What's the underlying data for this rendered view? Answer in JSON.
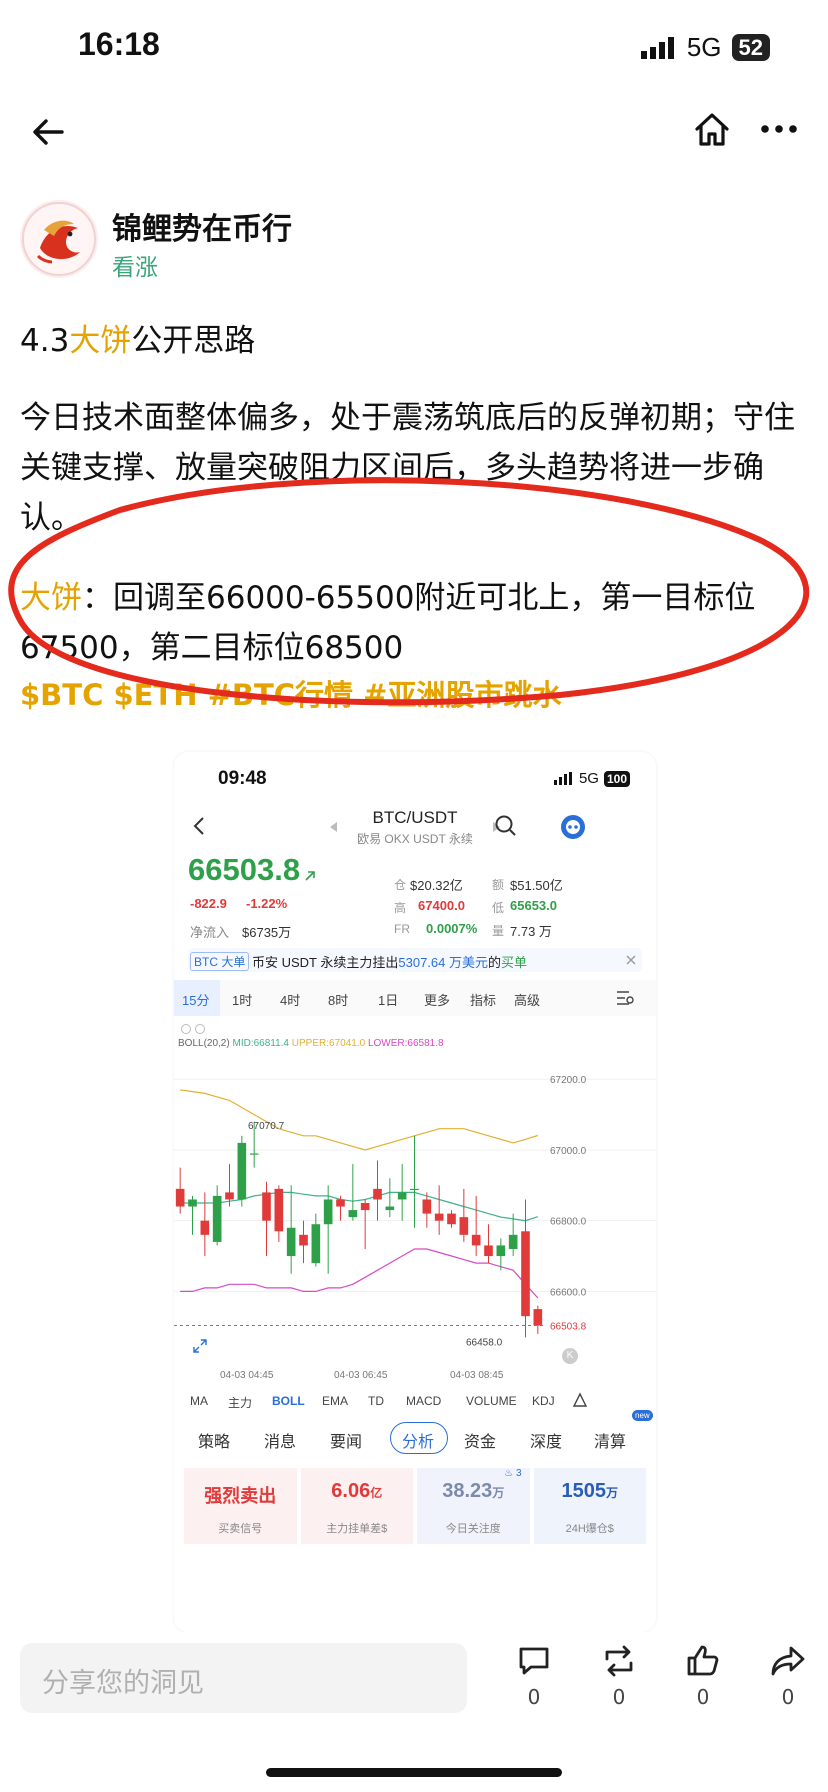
{
  "status": {
    "time": "16:18",
    "network": "5G",
    "battery": "52"
  },
  "nav": {
    "back_icon": "arrow-left-icon",
    "home_icon": "home-icon",
    "more_icon": "more-icon"
  },
  "author": {
    "name": "锦鲤势在币行",
    "tag": "看涨"
  },
  "post": {
    "title_pre": "4.3",
    "title_hl": "大饼",
    "title_post": "公开思路",
    "para1": "今日技术面整体偏多，处于震荡筑底后的反弹初期；守住关键支撑、放量突破阻力区间后，多头趋势将进一步确认。",
    "para2_hl": "大饼",
    "para2": "：回调至66000-65500附近可北上，第一目标位67500，第二目标位68500",
    "tags": "$BTC $ETH #BTC行情 #亚洲股市跳水"
  },
  "shot": {
    "time": "09:48",
    "network": "5G",
    "battery": "100",
    "pair": "BTC/USDT",
    "exchange": "欧易 OKX USDT 永续",
    "price": "66503.8",
    "change": "-822.9",
    "change_pct": "-1.22%",
    "netflow_label": "净流入",
    "netflow": "$6735万",
    "stats": {
      "oi_label": "仓",
      "oi": "$20.32亿",
      "vol_label": "额",
      "vol": "$51.50亿",
      "high_label": "高",
      "high": "67400.0",
      "low_label": "低",
      "low": "65653.0",
      "fr_label": "FR",
      "fr": "0.0007%",
      "qty_label": "量",
      "qty": "7.73 万"
    },
    "ticker_badge": "BTC 大单",
    "ticker_pre": "币安 USDT 永续主力挂出",
    "ticker_amount": "5307.64 万美元",
    "ticker_mid": "的",
    "ticker_end": "买单",
    "timeframes": [
      "15分",
      "1时",
      "4时",
      "8时",
      "1日",
      "更多",
      "指标",
      "高级"
    ],
    "boll_label": "BOLL(20,2)",
    "mid": "MID:66811.4",
    "upper": "UPPER:67041.0",
    "lower": "LOWER:66581.8",
    "y_ticks": [
      "67200.0",
      "67000.0",
      "66800.0",
      "66600.0"
    ],
    "last_price": "66503.8",
    "max_label": "67070.7",
    "min_label": "66458.0",
    "x_ticks": [
      "04-03 04:45",
      "04-03 06:45",
      "04-03 08:45"
    ],
    "indicators": [
      "MA",
      "主力",
      "BOLL",
      "EMA",
      "TD",
      "MACD",
      "VOLUME",
      "KDJ"
    ],
    "tabs": [
      "策略",
      "消息",
      "要闻",
      "分析",
      "资金",
      "深度",
      "清算"
    ],
    "new_badge": "new",
    "cards": [
      {
        "value": "强烈卖出",
        "unit": "",
        "label": "买卖信号"
      },
      {
        "value": "6.06",
        "unit": "亿",
        "label": "主力挂单差$"
      },
      {
        "value": "38.23",
        "unit": "万",
        "label": "今日关注度",
        "badge": "3"
      },
      {
        "value": "1505",
        "unit": "万",
        "label": "24H爆仓$"
      }
    ]
  },
  "comment": {
    "placeholder": "分享您的洞见"
  },
  "actions": [
    {
      "icon": "comment-icon",
      "count": "0"
    },
    {
      "icon": "repost-icon",
      "count": "0"
    },
    {
      "icon": "like-icon",
      "count": "0"
    },
    {
      "icon": "share-icon",
      "count": "0"
    }
  ],
  "chart_data": {
    "type": "candlestick",
    "x": [
      "04-03 04:45",
      "04-03 06:45",
      "04-03 08:45"
    ],
    "ylim": [
      66440,
      67260
    ],
    "candles": [
      [
        66890,
        66950,
        66820,
        66840
      ],
      [
        66840,
        66870,
        66760,
        66860
      ],
      [
        66800,
        66880,
        66700,
        66760
      ],
      [
        66740,
        66900,
        66730,
        66870
      ],
      [
        66880,
        66960,
        66840,
        66860
      ],
      [
        66860,
        67040,
        66840,
        67020
      ],
      [
        66990,
        67080,
        66950,
        66990
      ],
      [
        66880,
        66910,
        66700,
        66800
      ],
      [
        66890,
        66900,
        66740,
        66770
      ],
      [
        66700,
        66900,
        66650,
        66780
      ],
      [
        66760,
        66800,
        66680,
        66730
      ],
      [
        66680,
        66820,
        66670,
        66790
      ],
      [
        66790,
        66900,
        66650,
        66860
      ],
      [
        66860,
        66870,
        66800,
        66840
      ],
      [
        66810,
        66960,
        66800,
        66830
      ],
      [
        66850,
        66860,
        66720,
        66830
      ],
      [
        66890,
        66970,
        66800,
        66860
      ],
      [
        66830,
        66920,
        66810,
        66840
      ],
      [
        66860,
        66960,
        66800,
        66880
      ],
      [
        66890,
        67040,
        66780,
        66890
      ],
      [
        66860,
        66880,
        66780,
        66820
      ],
      [
        66820,
        66900,
        66760,
        66800
      ],
      [
        66820,
        66830,
        66780,
        66790
      ],
      [
        66810,
        66890,
        66740,
        66760
      ],
      [
        66760,
        66870,
        66700,
        66730
      ],
      [
        66730,
        66790,
        66680,
        66700
      ],
      [
        66700,
        66750,
        66660,
        66730
      ],
      [
        66720,
        66820,
        66700,
        66760
      ],
      [
        66770,
        66860,
        66470,
        66530
      ],
      [
        66550,
        66560,
        66480,
        66503.8
      ]
    ],
    "boll_upper": [
      67170,
      67165,
      67160,
      67150,
      67140,
      67120,
      67100,
      67080,
      67060,
      67050,
      67040,
      67040,
      67030,
      67020,
      67010,
      67000,
      67010,
      67020,
      67030,
      67040,
      67050,
      67060,
      67060,
      67060,
      67050,
      67040,
      67030,
      67020,
      67030,
      67041
    ],
    "boll_mid": [
      66850,
      66850,
      66850,
      66850,
      66855,
      66860,
      66870,
      66875,
      66880,
      66880,
      66875,
      66870,
      66870,
      66860,
      66855,
      66860,
      66870,
      66880,
      66880,
      66880,
      66870,
      66860,
      66850,
      66840,
      66830,
      66820,
      66810,
      66805,
      66800,
      66811.4
    ],
    "boll_lower": [
      66600,
      66600,
      66610,
      66610,
      66620,
      66620,
      66620,
      66610,
      66610,
      66610,
      66600,
      66600,
      66610,
      66610,
      66620,
      66640,
      66660,
      66680,
      66700,
      66720,
      66720,
      66710,
      66700,
      66690,
      66680,
      66680,
      66670,
      66660,
      66620,
      66581.8
    ]
  }
}
